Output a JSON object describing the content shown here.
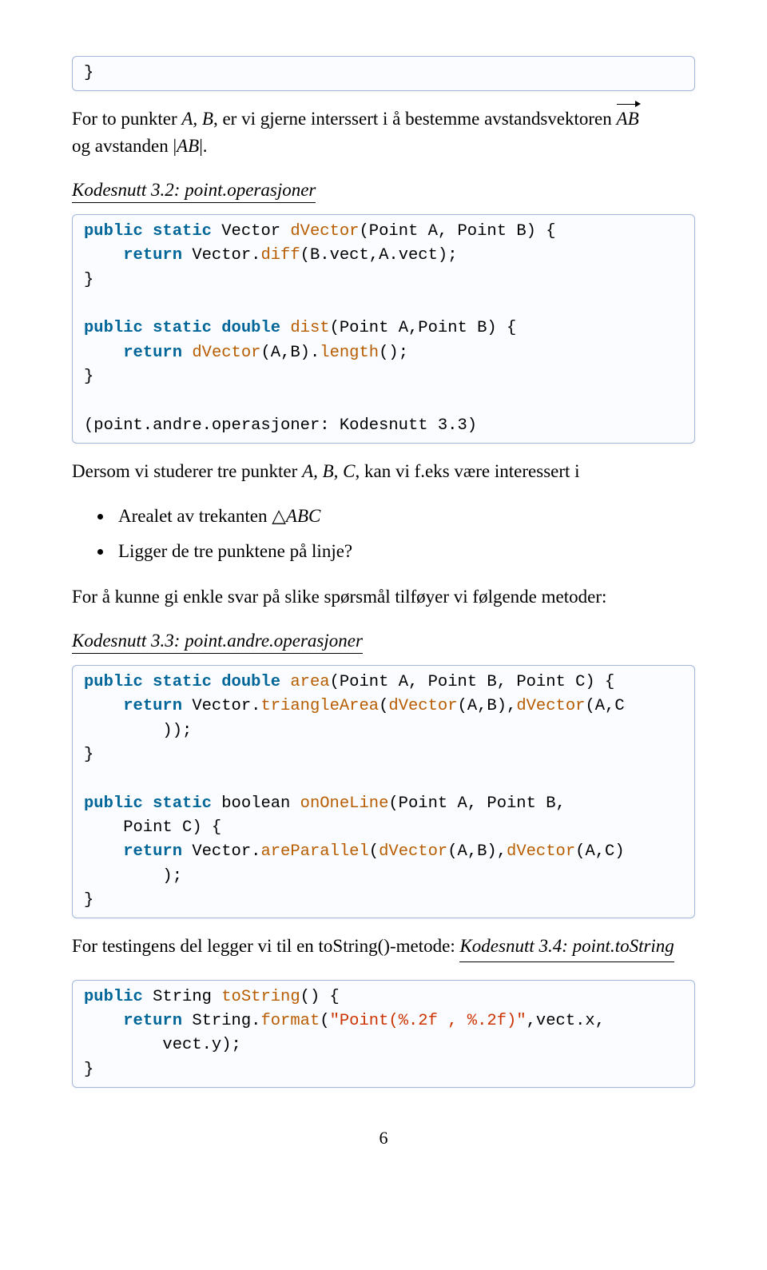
{
  "code1": {
    "brace": "}"
  },
  "para1": {
    "t1": "For to punkter ",
    "AB": "A, B",
    "t2": ", er vi gjerne interssert i å bestemme avstandsvektoren ",
    "vecAB": "AB",
    "t3": "og avstanden ",
    "absAB": "|AB|",
    "period": "."
  },
  "cap2": "Kodesnutt 3.2: point.operasjoner",
  "code2": {
    "l1a": "public static",
    "l1b": " Vector ",
    "l1c": "dVector",
    "l1d": "(Point A, Point B) {",
    "l2a": "    ",
    "l2b": "return",
    "l2c": " Vector.",
    "l2d": "diff",
    "l2e": "(B.vect,A.vect);",
    "l3": "}",
    "blank": "",
    "l4a": "public static double",
    "l4b": " ",
    "l4c": "dist",
    "l4d": "(Point A,Point B) {",
    "l5a": "    ",
    "l5b": "return",
    "l5c": " ",
    "l5d": "dVector",
    "l5e": "(A,B).",
    "l5f": "length",
    "l5g": "();",
    "l6": "}",
    "l7": "(point.andre.operasjoner: Kodesnutt 3.3)"
  },
  "para2": {
    "t1": "Dersom vi studerer tre punkter ",
    "ABC": "A, B, C",
    "t2": ", kan vi f.eks være interessert i"
  },
  "bullets": {
    "b1a": "Arealet av trekanten ",
    "b1b": "△",
    "b1c": "ABC",
    "b2": "Ligger de tre punktene på linje?"
  },
  "para3": "For å kunne gi enkle svar på slike spørsmål tilføyer vi følgende metoder:",
  "cap3": "Kodesnutt 3.3: point.andre.operasjoner",
  "code3": {
    "l1a": "public static double",
    "l1b": " ",
    "l1c": "area",
    "l1d": "(Point A, Point B, Point C) {",
    "l2a": "    ",
    "l2b": "return",
    "l2c": " Vector.",
    "l2d": "triangleArea",
    "l2e": "(",
    "l2f": "dVector",
    "l2g": "(A,B),",
    "l2h": "dVector",
    "l2i": "(A,C",
    "l3": "        ));",
    "l4": "}",
    "blank": "",
    "l5a": "public static",
    "l5b": " boolean ",
    "l5c": "onOneLine",
    "l5d": "(Point A, Point B,",
    "l6": "    Point C) {",
    "l7a": "    ",
    "l7b": "return",
    "l7c": " Vector.",
    "l7d": "areParallel",
    "l7e": "(",
    "l7f": "dVector",
    "l7g": "(A,B),",
    "l7h": "dVector",
    "l7i": "(A,C)",
    "l8": "        );",
    "l9": "}"
  },
  "para4": {
    "t1": "For testingens del legger vi til en toString()-metode: "
  },
  "cap4": "Kodesnutt 3.4: point.toString",
  "code4": {
    "l1a": "public",
    "l1b": " String ",
    "l1c": "toString",
    "l1d": "() {",
    "l2a": "    ",
    "l2b": "return",
    "l2c": " String.",
    "l2d": "format",
    "l2e": "(",
    "l2f": "\"Point(%.2f , %.2f)\"",
    "l2g": ",vect.x,",
    "l3": "        vect.y);",
    "l4": "}"
  },
  "pagenum": "6"
}
